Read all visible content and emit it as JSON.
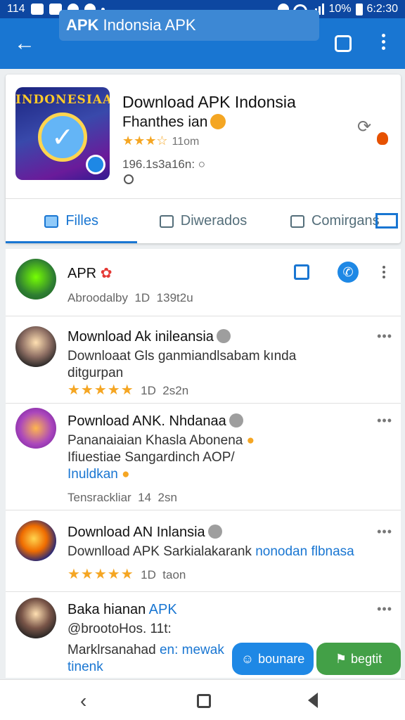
{
  "status_bar": {
    "time_left": "114",
    "battery": "10%",
    "clock": "6:2:30"
  },
  "app_bar": {
    "search_bold": "APK",
    "search_text": "Indonsia APK"
  },
  "header": {
    "logo_text": "INDONESIAA",
    "title": "Download APK Indonsia",
    "subtitle": "Fhanthes ian",
    "rating_stars": "★★★☆",
    "rating_meta": "11om",
    "id_text": "196.1s3a16n:"
  },
  "tabs": [
    {
      "label": "Filles"
    },
    {
      "label": "Diwerados"
    },
    {
      "label": "Comirgans"
    }
  ],
  "list": {
    "items": [
      {
        "title": "APR",
        "meta_left": "Abroodalby",
        "meta_num": "1D",
        "meta_right": "139t2u"
      },
      {
        "title": "Mownload Ak inileansia",
        "text": "Downloaat Gls ganmiandlsabam kında",
        "text2": "ditgurpan",
        "stars": "★★★★★",
        "meta_num": "1D",
        "meta_right": "2s2n"
      },
      {
        "title": "Pownload ANK. Nhdanaa",
        "text": "Pananaiaian Khasla Abonena",
        "text2": "Ifiuestiae Sangardinch AOP/",
        "text3": "Inuldkan",
        "meta_left": "Tensrackliar",
        "meta_num": "14",
        "meta_right": "2sn"
      },
      {
        "title": "Download AN Inlansia",
        "text": "Downlload APK Sarkialakarank",
        "text_link": "nonodan flbnasa",
        "stars": "★★★★★",
        "meta_num": "1D",
        "meta_right": "taon"
      },
      {
        "title": "Baka hianan",
        "title_link": "APK",
        "text": "@brootoHos. 11t:",
        "text2": "Marklrsanahad",
        "text2_link": "en: mewak",
        "text3": "tinenk"
      }
    ],
    "more": "•••"
  },
  "buttons": {
    "left": "bounare",
    "right": "begtit"
  },
  "colors": {
    "app_bar": "#1976d2",
    "status_bar": "#0d47a1",
    "accent": "#1976d2",
    "star": "#f5a623",
    "fab_green": "#43a047"
  }
}
